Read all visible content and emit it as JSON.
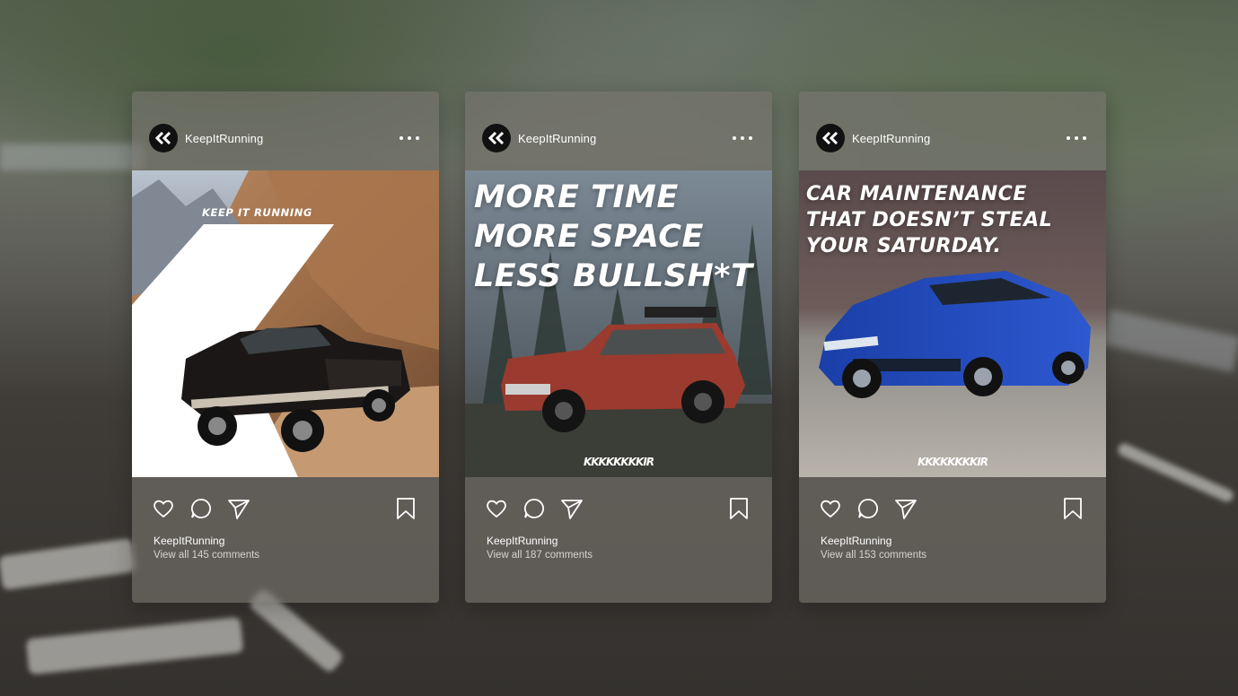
{
  "colors": {
    "card_overlay": "#78746e",
    "text_primary": "#ffffff",
    "text_secondary": "#e6e6e6",
    "avatar_bg": "#111111"
  },
  "icons": {
    "avatar": "double-chevron-left-logo",
    "more": "more-dots-icon",
    "like": "heart-icon",
    "comment": "comment-bubble-icon",
    "share": "paper-plane-icon",
    "save": "bookmark-icon"
  },
  "posts": [
    {
      "account": "KeepItRunning",
      "image_text": "KEEP IT RUNNING",
      "image_headline": [],
      "owner": "KeepItRunning",
      "comments_link": "View all 145 comments"
    },
    {
      "account": "KeepItRunning",
      "image_text": "KKKKKKKKIR",
      "image_headline": [
        "MORE TIME",
        "MORE SPACE",
        "LESS BULLSH*T"
      ],
      "owner": "KeepItRunning",
      "comments_link": "View all 187 comments"
    },
    {
      "account": "KeepItRunning",
      "image_text": "KKKKKKKKIR",
      "image_headline": [
        "CAR MAINTENANCE",
        "THAT DOESN’T STEAL",
        "YOUR SATURDAY."
      ],
      "owner": "KeepItRunning",
      "comments_link": "View all 153 comments"
    }
  ]
}
